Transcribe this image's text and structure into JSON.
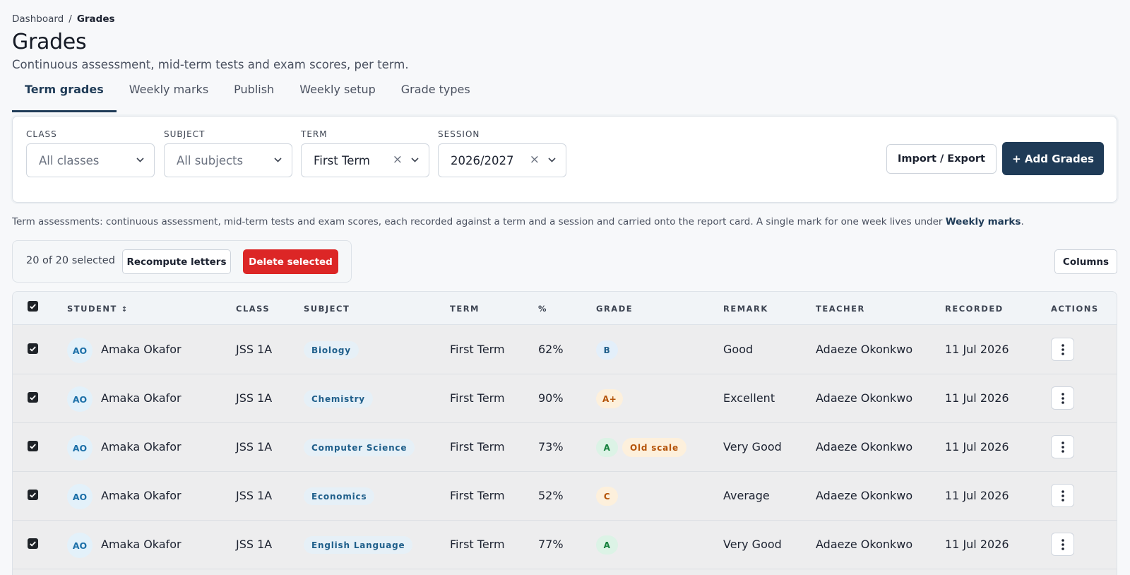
{
  "breadcrumb": {
    "parent": "Dashboard",
    "separator": "/",
    "current": "Grades"
  },
  "page": {
    "title": "Grades",
    "subtitle": "Continuous assessment, mid-term tests and exam scores, per term."
  },
  "tabs": [
    "Term grades",
    "Weekly marks",
    "Publish",
    "Weekly setup",
    "Grade types"
  ],
  "filters": {
    "class": {
      "label": "CLASS",
      "value": "All classes"
    },
    "subject": {
      "label": "SUBJECT",
      "value": "All subjects"
    },
    "term": {
      "label": "TERM",
      "value": "First Term",
      "clear": "×"
    },
    "session": {
      "label": "SESSION",
      "value": "2026/2027",
      "clear": "×"
    },
    "import_export_label": "Import / Export",
    "add_grades_label": "+ Add Grades"
  },
  "info": {
    "text": "Term assessments: continuous assessment, mid-term tests and exam scores, each recorded against a term and a session and carried onto the report card. A single mark for one week lives under ",
    "link": "Weekly marks",
    "end": "."
  },
  "bulk": {
    "selected_text": "20 of 20 selected",
    "recompute_label": "Recompute letters",
    "delete_label": "Delete selected",
    "columns_label": "Columns"
  },
  "table": {
    "headers": {
      "student": "STUDENT",
      "class": "CLASS",
      "subject": "SUBJECT",
      "term": "TERM",
      "percent": "%",
      "grade": "GRADE",
      "remark": "REMARK",
      "teacher": "TEACHER",
      "recorded": "RECORDED",
      "actions": "ACTIONS"
    },
    "rows": [
      {
        "initials": "AO",
        "student": "Amaka Okafor",
        "class": "JSS 1A",
        "subject": "Biology",
        "term": "First Term",
        "percent": "62%",
        "grade": "B",
        "grade_color": "#e3effa",
        "grade_text": "#1f5f8b",
        "old_scale": "",
        "remark": "Good",
        "teacher": "Adaeze Okonkwo",
        "recorded": "11 Jul 2026"
      },
      {
        "initials": "AO",
        "student": "Amaka Okafor",
        "class": "JSS 1A",
        "subject": "Chemistry",
        "term": "First Term",
        "percent": "90%",
        "grade": "A+",
        "grade_color": "#fdf0dc",
        "grade_text": "#b45309",
        "old_scale": "",
        "remark": "Excellent",
        "teacher": "Adaeze Okonkwo",
        "recorded": "11 Jul 2026"
      },
      {
        "initials": "AO",
        "student": "Amaka Okafor",
        "class": "JSS 1A",
        "subject": "Computer Science",
        "term": "First Term",
        "percent": "73%",
        "grade": "A",
        "grade_color": "#dcf3e6",
        "grade_text": "#15803d",
        "old_scale": "Old scale",
        "remark": "Very Good",
        "teacher": "Adaeze Okonkwo",
        "recorded": "11 Jul 2026"
      },
      {
        "initials": "AO",
        "student": "Amaka Okafor",
        "class": "JSS 1A",
        "subject": "Economics",
        "term": "First Term",
        "percent": "52%",
        "grade": "C",
        "grade_color": "#fdf0dc",
        "grade_text": "#b45309",
        "old_scale": "",
        "remark": "Average",
        "teacher": "Adaeze Okonkwo",
        "recorded": "11 Jul 2026"
      },
      {
        "initials": "AO",
        "student": "Amaka Okafor",
        "class": "JSS 1A",
        "subject": "English Language",
        "term": "First Term",
        "percent": "77%",
        "grade": "A",
        "grade_color": "#dcf3e6",
        "grade_text": "#15803d",
        "old_scale": "",
        "remark": "Very Good",
        "teacher": "Adaeze Okonkwo",
        "recorded": "11 Jul 2026"
      }
    ]
  },
  "icons": {
    "chevron": "chevron-down-icon",
    "clear": "close-icon",
    "sort": "sort-icon",
    "checkbox": "checkbox-checked-icon",
    "kebab": "more-vertical-icon"
  },
  "colors": {
    "primary": "#1f3b57",
    "danger": "#dc2626",
    "pill_bg": "#e6f0f7"
  }
}
